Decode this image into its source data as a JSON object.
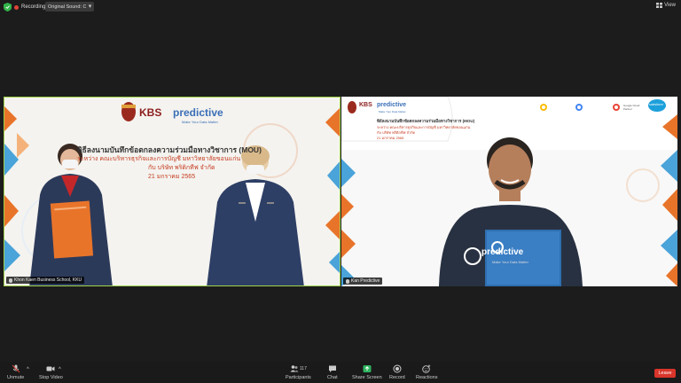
{
  "topbar": {
    "recording_label": "Recording",
    "sound_label": "Original Sound: On",
    "view_label": "View"
  },
  "left_tile": {
    "name": "Khon Kaen Business School, KKU",
    "banner_title": "พิธีลงนามบันทึกข้อตกลงความร่วมมือทางวิชาการ (MOU)",
    "banner_sub": "ระหว่าง คณะบริหารธุรกิจและการบัญชี มหาวิทยาลัยขอนแก่น",
    "banner_company": "กับ บริษัท พริดิกทีฟ จำกัด",
    "banner_date": "21 มกราคม 2565",
    "logo_kbs": "KBS",
    "logo_predictive": "predictive",
    "logo_tagline": "Make Your Data Matter"
  },
  "right_tile": {
    "name": "Kan Predictive",
    "banner_title": "พิธีลงนามบันทึกข้อตกลงความร่วมมือทางวิชาการ (MOU)",
    "banner_sub": "ระหว่าง คณะบริหารธุรกิจและการบัญชี มหาวิทยาลัยขอนแก่น",
    "banner_company": "กับ บริษัท พริดิกทีฟ จำกัด",
    "banner_date": "21 มกราคม 2565",
    "logo_kbs": "KBS",
    "logo_predictive": "predictive",
    "logo_tagline": "Make Your Data Matter",
    "partner_google": "Google Cloud Partner",
    "partner_sf": "salesforce",
    "shirt_brand": "predictive",
    "shirt_tagline": "Make Your Data Matter",
    "board_brand": "predictive"
  },
  "toolbar": {
    "unmute": "Unmute",
    "stop_video": "Stop Video",
    "participants": "Participants",
    "participants_count": "117",
    "chat": "Chat",
    "share_screen": "Share Screen",
    "record": "Record",
    "reactions": "Reactions",
    "leave": "Leave"
  },
  "colors": {
    "accent_green": "#9fd24a",
    "leave_red": "#d9352a",
    "share_green": "#2fb35f",
    "backdrop_orange": "#e8742a",
    "backdrop_blue": "#4aa3d9",
    "brand_blue": "#3a6fb7"
  }
}
